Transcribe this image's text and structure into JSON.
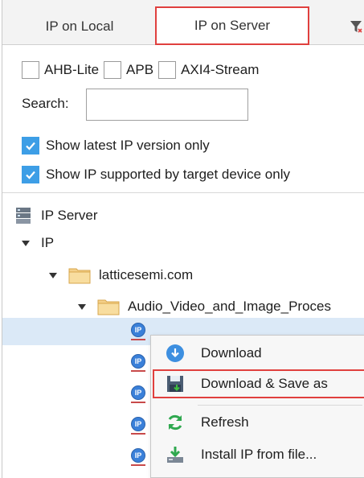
{
  "tabs": [
    {
      "label": "IP on Local"
    },
    {
      "label": "IP on Server"
    }
  ],
  "filters": {
    "bus_types": [
      {
        "label": "AHB-Lite",
        "checked": false
      },
      {
        "label": "APB",
        "checked": false
      },
      {
        "label": "AXI4-Stream",
        "checked": false
      }
    ],
    "search_label": "Search:",
    "search_value": "",
    "show_latest": {
      "label": "Show latest IP version only",
      "checked": true
    },
    "show_supported": {
      "label": "Show IP supported by target device only",
      "checked": true
    }
  },
  "tree": {
    "root": "IP Server",
    "ip": "IP",
    "vendor": "latticesemi.com",
    "category": "Audio_Video_and_Image_Proces"
  },
  "context_menu": {
    "items": [
      {
        "label": "Download",
        "icon": "download-icon"
      },
      {
        "label": "Download & Save as",
        "icon": "save-icon"
      },
      {
        "label": "Refresh",
        "icon": "refresh-icon"
      },
      {
        "label": "Install IP from file...",
        "icon": "install-icon"
      }
    ]
  },
  "colors": {
    "highlight_border": "#e0403e",
    "checkbox_checked": "#3d9ee6",
    "selection": "#dbe9f7"
  }
}
